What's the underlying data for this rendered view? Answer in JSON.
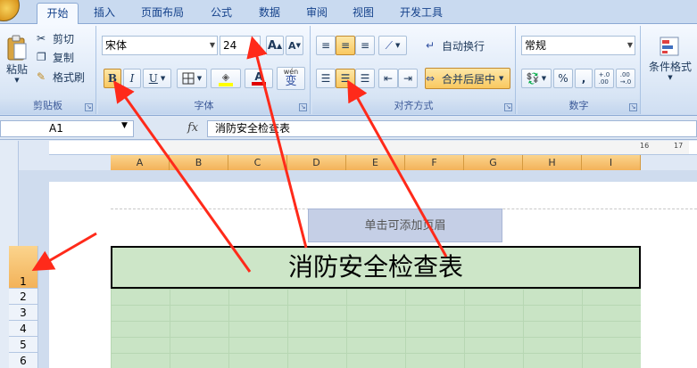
{
  "tabs": [
    {
      "label": "开始",
      "active": true
    },
    {
      "label": "插入"
    },
    {
      "label": "页面布局"
    },
    {
      "label": "公式"
    },
    {
      "label": "数据"
    },
    {
      "label": "审阅"
    },
    {
      "label": "视图"
    },
    {
      "label": "开发工具"
    }
  ],
  "clipboard": {
    "paste_label": "粘贴",
    "cut_label": "剪切",
    "copy_label": "复制",
    "format_painter_label": "格式刷",
    "group_label": "剪贴板"
  },
  "font": {
    "font_name": "宋体",
    "font_size": "24",
    "bold": "B",
    "italic": "I",
    "underline": "U",
    "grow_font": "A",
    "shrink_font": "A",
    "font_color_letter": "A",
    "phonetic": "wén",
    "phonetic_char": "变",
    "group_label": "字体"
  },
  "alignment": {
    "wrap_text_label": "自动换行",
    "merge_center_label": "合并后居中",
    "group_label": "对齐方式"
  },
  "number": {
    "format_value": "常规",
    "percent": "%",
    "comma": ",",
    "inc_decimal": "+.0\n.00",
    "dec_decimal": ".00\n→.0",
    "group_label": "数字"
  },
  "styles": {
    "conditional_format_label": "条件格式"
  },
  "formula_bar": {
    "cell_ref": "A1",
    "fx": "fx",
    "content": "消防安全检查表"
  },
  "columns": [
    "A",
    "B",
    "C",
    "D",
    "E",
    "F",
    "G",
    "H",
    "I"
  ],
  "rows": [
    "1",
    "2",
    "3",
    "4",
    "5",
    "6"
  ],
  "ruler_marks": [
    "16",
    "17"
  ],
  "sheet": {
    "header_placeholder": "单击可添加页眉",
    "title": "消防安全检查表"
  },
  "colors": {
    "arrow": "#ff2a1a",
    "grid_fill": "#c9e4c5",
    "selection_header": "#f3b259"
  }
}
